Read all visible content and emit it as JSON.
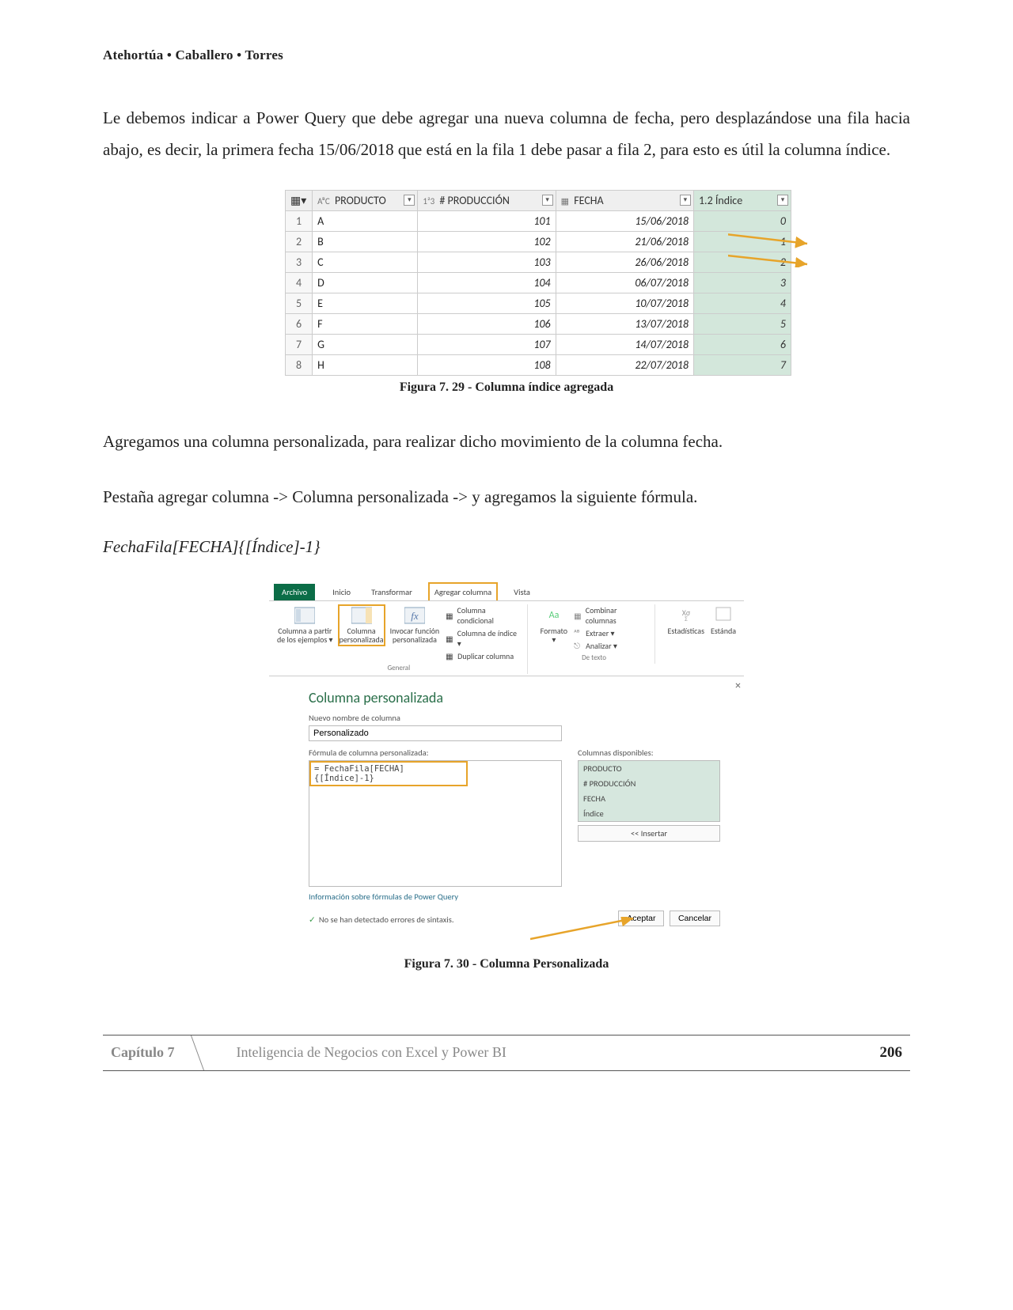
{
  "authors": "Atehortúa • Caballero • Torres",
  "para1": "Le debemos indicar a Power Query que debe agregar una nueva columna de fecha, pero desplazándose una fila hacia abajo, es decir, la primera fecha 15/06/2018 que está en la fila 1 debe pasar a fila 2, para esto es útil la columna índice.",
  "para2": "Agregamos una columna personalizada, para realizar dicho movimiento de la columna fecha.",
  "para3": "Pestaña agregar columna -> Columna personalizada -> y agregamos la siguiente fórmula.",
  "formula_line": "FechaFila[FECHA]{[Índice]-1}",
  "caption1": "Figura 7. 29 - Columna índice agregada",
  "caption2": "Figura 7. 30 - Columna Personalizada",
  "table": {
    "headers": {
      "producto": "PRODUCTO",
      "produccion": "# PRODUCCIÓN",
      "fecha": "FECHA",
      "indice": "1.2  Índice",
      "abc": "AᴮC",
      "n123": "1²3"
    },
    "rows": [
      {
        "n": "1",
        "p": "A",
        "pr": "101",
        "f": "15/06/2018",
        "i": "0"
      },
      {
        "n": "2",
        "p": "B",
        "pr": "102",
        "f": "21/06/2018",
        "i": "1"
      },
      {
        "n": "3",
        "p": "C",
        "pr": "103",
        "f": "26/06/2018",
        "i": "2"
      },
      {
        "n": "4",
        "p": "D",
        "pr": "104",
        "f": "06/07/2018",
        "i": "3"
      },
      {
        "n": "5",
        "p": "E",
        "pr": "105",
        "f": "10/07/2018",
        "i": "4"
      },
      {
        "n": "6",
        "p": "F",
        "pr": "106",
        "f": "13/07/2018",
        "i": "5"
      },
      {
        "n": "7",
        "p": "G",
        "pr": "107",
        "f": "14/07/2018",
        "i": "6"
      },
      {
        "n": "8",
        "p": "H",
        "pr": "108",
        "f": "22/07/2018",
        "i": "7"
      }
    ]
  },
  "ribbon": {
    "tabs": {
      "file": "Archivo",
      "home": "Inicio",
      "transform": "Transformar",
      "add": "Agregar columna",
      "view": "Vista"
    },
    "buttons": {
      "from_examples": "Columna a partir\nde los ejemplos ▾",
      "custom_col": "Columna\npersonalizada",
      "invoke_fn": "Invocar función\npersonalizada",
      "cond_col": "Columna condicional",
      "index_col": "Columna de índice ▾",
      "dup_col": "Duplicar columna",
      "format": "Formato\n▾",
      "merge": "Combinar columnas",
      "extract": "Extraer ▾",
      "analyze": "Analizar ▾",
      "stats": "Estadísticas",
      "standard": "Estánda"
    },
    "groups": {
      "general": "General",
      "detexto": "De texto"
    }
  },
  "dialog": {
    "title": "Columna personalizada",
    "name_label": "Nuevo nombre de columna",
    "name_value": "Personalizado",
    "formula_label": "Fórmula de columna personalizada:",
    "formula_value": "= FechaFila[FECHA]{[Índice]-1}",
    "available_label": "Columnas disponibles:",
    "available": [
      "PRODUCTO",
      "# PRODUCCIÓN",
      "FECHA",
      "Índice"
    ],
    "insert": "<< Insertar",
    "info_link": "Información sobre fórmulas de Power Query",
    "status": "No se han detectado errores de sintaxis.",
    "ok": "Aceptar",
    "cancel": "Cancelar"
  },
  "footer": {
    "chapter": "Capítulo 7",
    "book": "Inteligencia de Negocios con Excel y Power BI",
    "page": "206"
  }
}
